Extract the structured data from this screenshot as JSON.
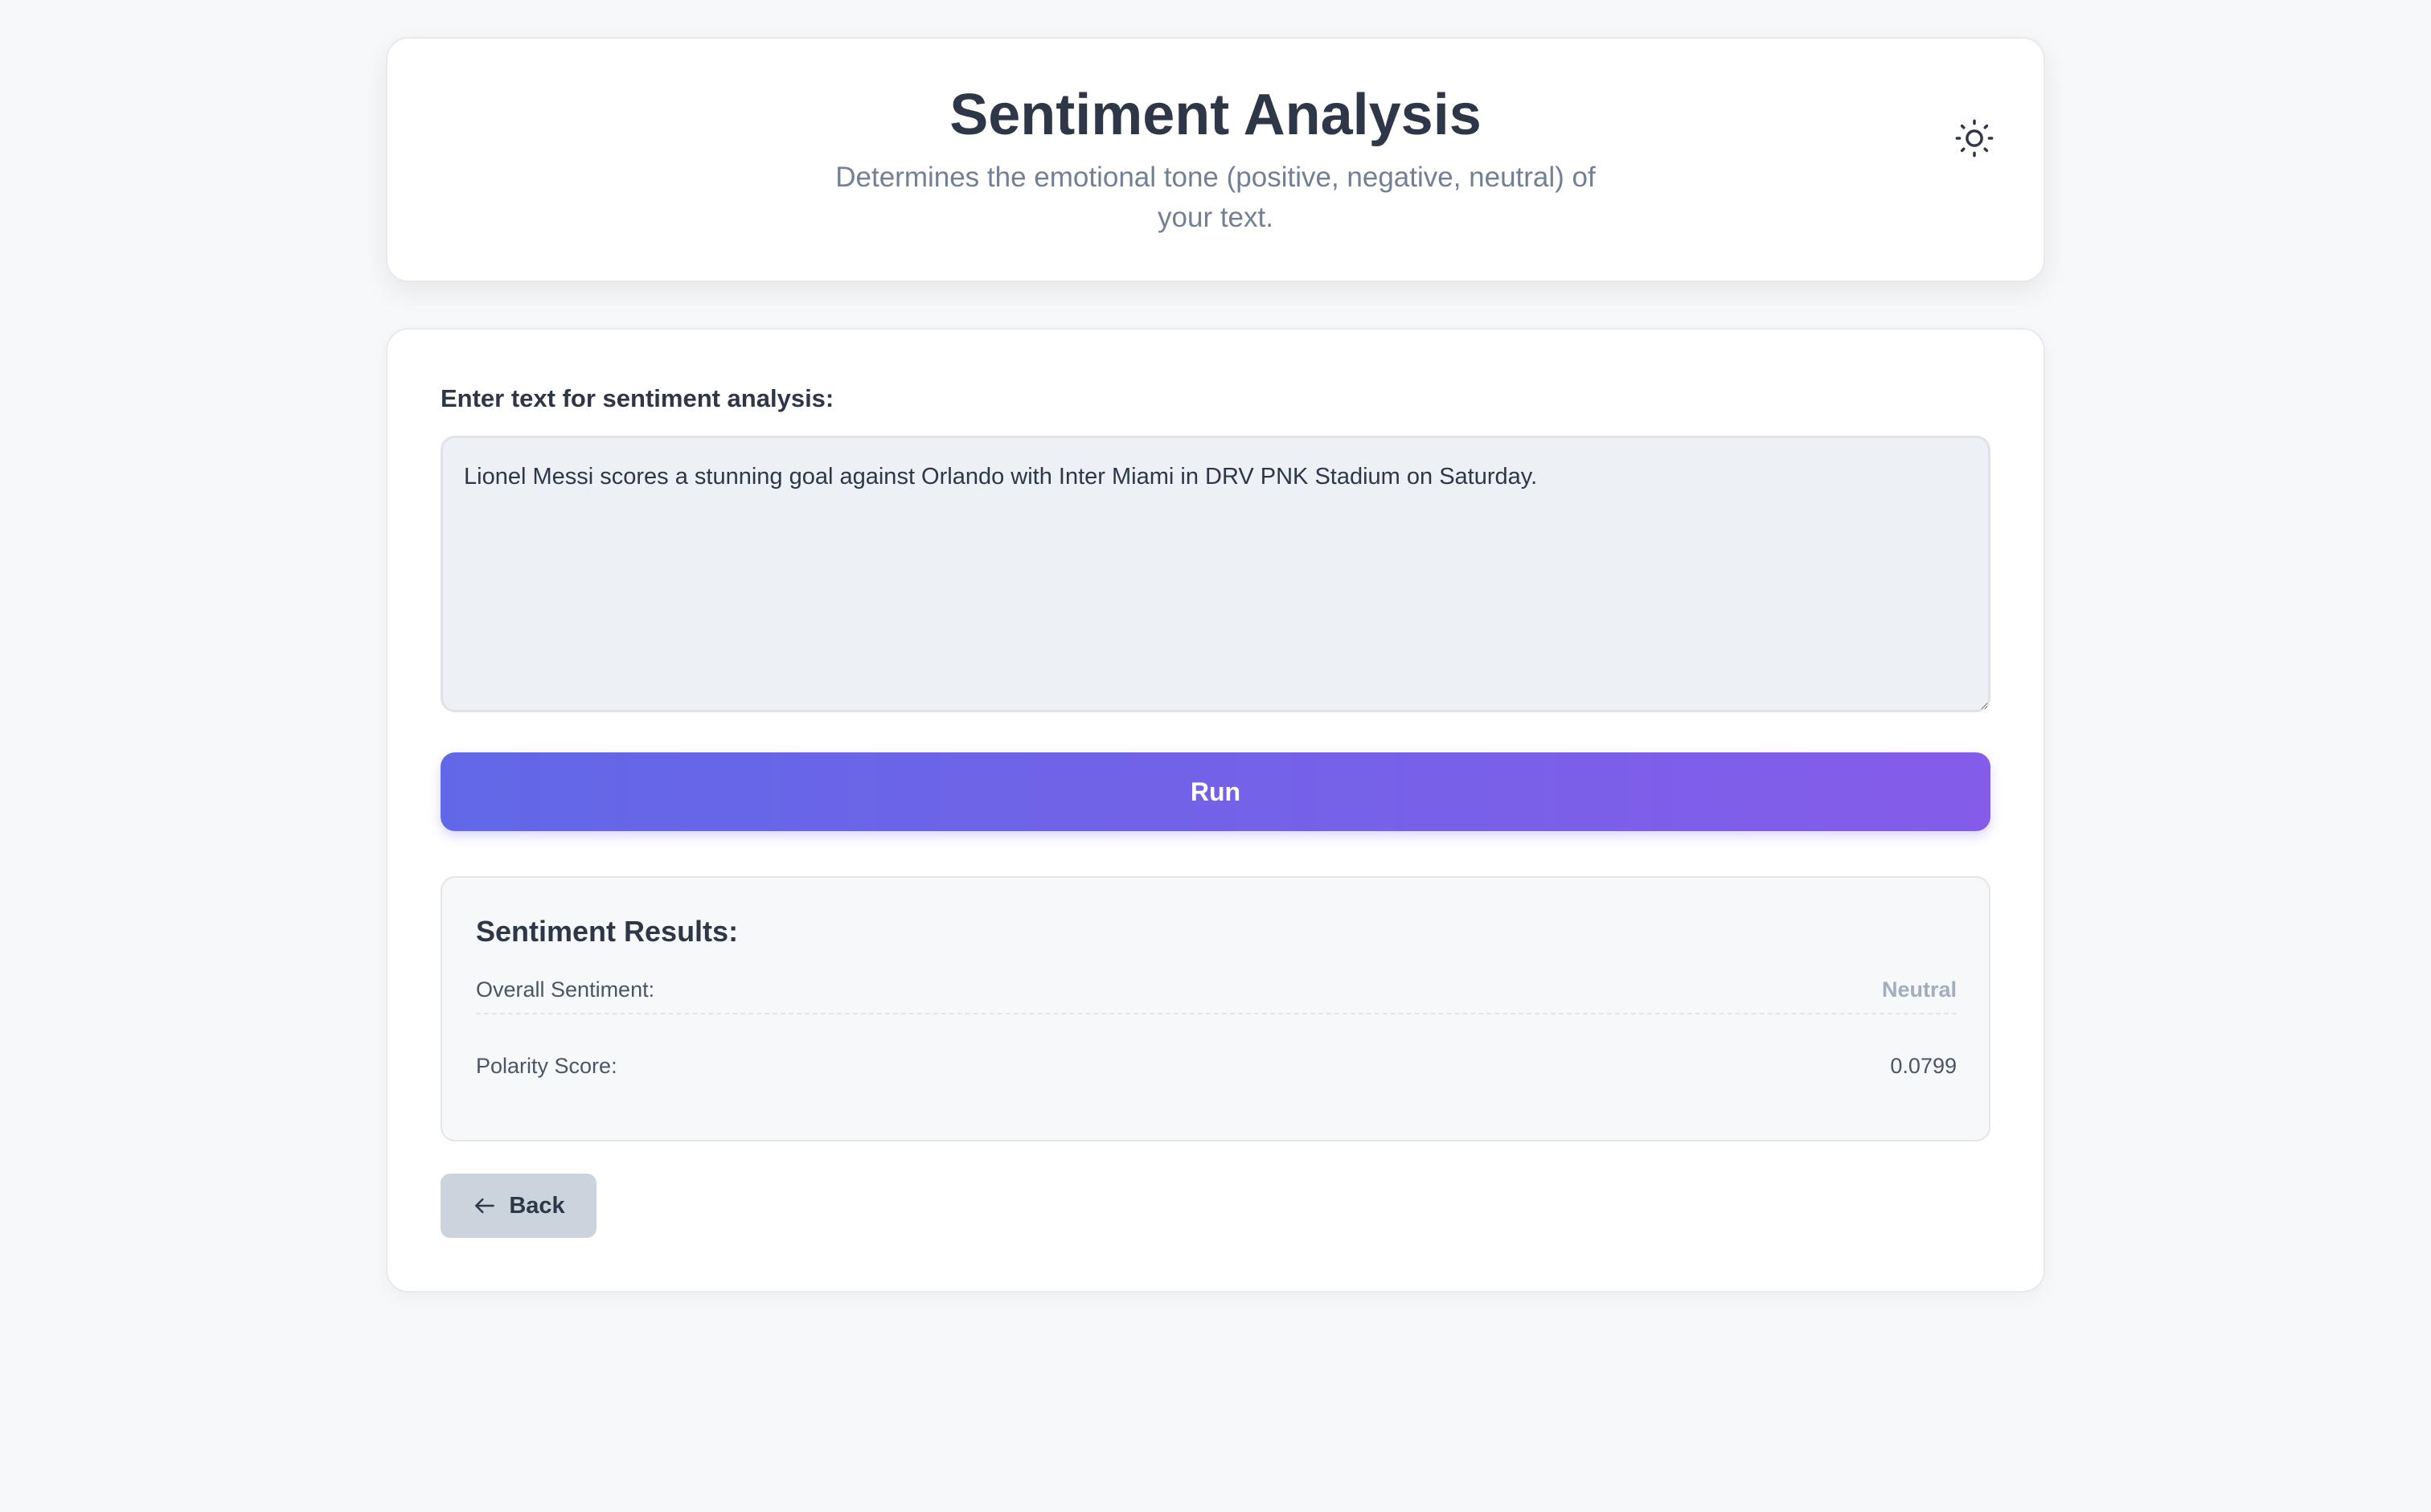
{
  "header": {
    "title": "Sentiment Analysis",
    "subtitle": "Determines the emotional tone (positive, negative, neutral) of your text.",
    "theme_toggle_icon": "sun-icon"
  },
  "form": {
    "label": "Enter text for sentiment analysis:",
    "text_value": "Lionel Messi scores a stunning goal against Orlando with Inter Miami in DRV PNK Stadium on Saturday.",
    "run_label": "Run"
  },
  "results": {
    "heading": "Sentiment Results:",
    "rows": [
      {
        "label": "Overall Sentiment:",
        "value": "Neutral"
      },
      {
        "label": "Polarity Score:",
        "value": "0.0799"
      }
    ]
  },
  "navigation": {
    "back_label": "Back",
    "back_icon": "arrow-left-icon"
  },
  "colors": {
    "accent_start": "#6168e7",
    "accent_end": "#855cea",
    "neutral_status": "#a0aec0",
    "background": "#f7f8fa"
  }
}
